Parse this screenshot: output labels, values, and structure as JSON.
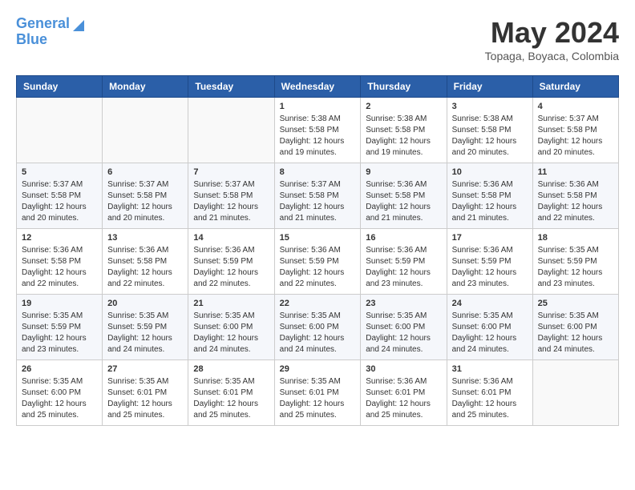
{
  "header": {
    "logo_line1": "General",
    "logo_line2": "Blue",
    "month_title": "May 2024",
    "location": "Topaga, Boyaca, Colombia"
  },
  "weekdays": [
    "Sunday",
    "Monday",
    "Tuesday",
    "Wednesday",
    "Thursday",
    "Friday",
    "Saturday"
  ],
  "weeks": [
    [
      {
        "day": "",
        "info": ""
      },
      {
        "day": "",
        "info": ""
      },
      {
        "day": "",
        "info": ""
      },
      {
        "day": "1",
        "info": "Sunrise: 5:38 AM\nSunset: 5:58 PM\nDaylight: 12 hours\nand 19 minutes."
      },
      {
        "day": "2",
        "info": "Sunrise: 5:38 AM\nSunset: 5:58 PM\nDaylight: 12 hours\nand 19 minutes."
      },
      {
        "day": "3",
        "info": "Sunrise: 5:38 AM\nSunset: 5:58 PM\nDaylight: 12 hours\nand 20 minutes."
      },
      {
        "day": "4",
        "info": "Sunrise: 5:37 AM\nSunset: 5:58 PM\nDaylight: 12 hours\nand 20 minutes."
      }
    ],
    [
      {
        "day": "5",
        "info": "Sunrise: 5:37 AM\nSunset: 5:58 PM\nDaylight: 12 hours\nand 20 minutes."
      },
      {
        "day": "6",
        "info": "Sunrise: 5:37 AM\nSunset: 5:58 PM\nDaylight: 12 hours\nand 20 minutes."
      },
      {
        "day": "7",
        "info": "Sunrise: 5:37 AM\nSunset: 5:58 PM\nDaylight: 12 hours\nand 21 minutes."
      },
      {
        "day": "8",
        "info": "Sunrise: 5:37 AM\nSunset: 5:58 PM\nDaylight: 12 hours\nand 21 minutes."
      },
      {
        "day": "9",
        "info": "Sunrise: 5:36 AM\nSunset: 5:58 PM\nDaylight: 12 hours\nand 21 minutes."
      },
      {
        "day": "10",
        "info": "Sunrise: 5:36 AM\nSunset: 5:58 PM\nDaylight: 12 hours\nand 21 minutes."
      },
      {
        "day": "11",
        "info": "Sunrise: 5:36 AM\nSunset: 5:58 PM\nDaylight: 12 hours\nand 22 minutes."
      }
    ],
    [
      {
        "day": "12",
        "info": "Sunrise: 5:36 AM\nSunset: 5:58 PM\nDaylight: 12 hours\nand 22 minutes."
      },
      {
        "day": "13",
        "info": "Sunrise: 5:36 AM\nSunset: 5:58 PM\nDaylight: 12 hours\nand 22 minutes."
      },
      {
        "day": "14",
        "info": "Sunrise: 5:36 AM\nSunset: 5:59 PM\nDaylight: 12 hours\nand 22 minutes."
      },
      {
        "day": "15",
        "info": "Sunrise: 5:36 AM\nSunset: 5:59 PM\nDaylight: 12 hours\nand 22 minutes."
      },
      {
        "day": "16",
        "info": "Sunrise: 5:36 AM\nSunset: 5:59 PM\nDaylight: 12 hours\nand 23 minutes."
      },
      {
        "day": "17",
        "info": "Sunrise: 5:36 AM\nSunset: 5:59 PM\nDaylight: 12 hours\nand 23 minutes."
      },
      {
        "day": "18",
        "info": "Sunrise: 5:35 AM\nSunset: 5:59 PM\nDaylight: 12 hours\nand 23 minutes."
      }
    ],
    [
      {
        "day": "19",
        "info": "Sunrise: 5:35 AM\nSunset: 5:59 PM\nDaylight: 12 hours\nand 23 minutes."
      },
      {
        "day": "20",
        "info": "Sunrise: 5:35 AM\nSunset: 5:59 PM\nDaylight: 12 hours\nand 24 minutes."
      },
      {
        "day": "21",
        "info": "Sunrise: 5:35 AM\nSunset: 6:00 PM\nDaylight: 12 hours\nand 24 minutes."
      },
      {
        "day": "22",
        "info": "Sunrise: 5:35 AM\nSunset: 6:00 PM\nDaylight: 12 hours\nand 24 minutes."
      },
      {
        "day": "23",
        "info": "Sunrise: 5:35 AM\nSunset: 6:00 PM\nDaylight: 12 hours\nand 24 minutes."
      },
      {
        "day": "24",
        "info": "Sunrise: 5:35 AM\nSunset: 6:00 PM\nDaylight: 12 hours\nand 24 minutes."
      },
      {
        "day": "25",
        "info": "Sunrise: 5:35 AM\nSunset: 6:00 PM\nDaylight: 12 hours\nand 24 minutes."
      }
    ],
    [
      {
        "day": "26",
        "info": "Sunrise: 5:35 AM\nSunset: 6:00 PM\nDaylight: 12 hours\nand 25 minutes."
      },
      {
        "day": "27",
        "info": "Sunrise: 5:35 AM\nSunset: 6:01 PM\nDaylight: 12 hours\nand 25 minutes."
      },
      {
        "day": "28",
        "info": "Sunrise: 5:35 AM\nSunset: 6:01 PM\nDaylight: 12 hours\nand 25 minutes."
      },
      {
        "day": "29",
        "info": "Sunrise: 5:35 AM\nSunset: 6:01 PM\nDaylight: 12 hours\nand 25 minutes."
      },
      {
        "day": "30",
        "info": "Sunrise: 5:36 AM\nSunset: 6:01 PM\nDaylight: 12 hours\nand 25 minutes."
      },
      {
        "day": "31",
        "info": "Sunrise: 5:36 AM\nSunset: 6:01 PM\nDaylight: 12 hours\nand 25 minutes."
      },
      {
        "day": "",
        "info": ""
      }
    ]
  ]
}
